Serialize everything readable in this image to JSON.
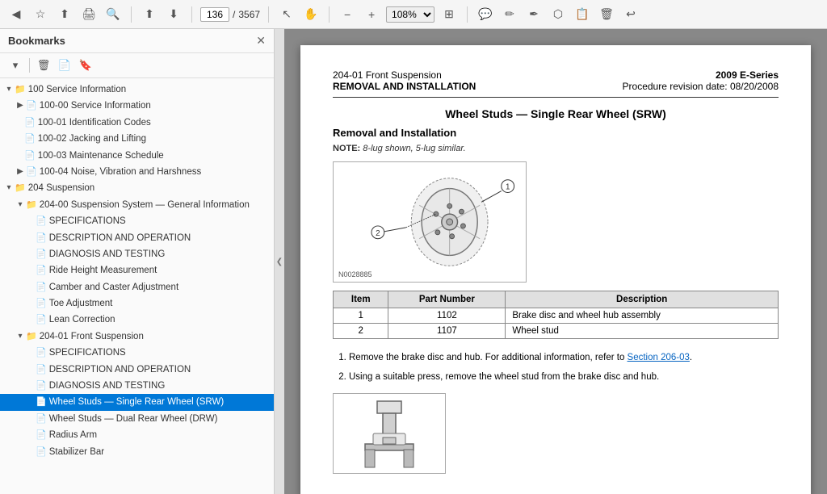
{
  "toolbar": {
    "page_current": "136",
    "page_total": "3567",
    "zoom": "108%",
    "nav_back_label": "◀",
    "nav_forward_label": "▶"
  },
  "sidebar": {
    "title": "Bookmarks",
    "close_btn": "✕",
    "tools": [
      "▾",
      "🗑",
      "📄",
      "🔖"
    ],
    "tree": [
      {
        "id": "s100",
        "indent": 0,
        "expanded": true,
        "type": "folder",
        "label": "100 Service Information"
      },
      {
        "id": "s100-00",
        "indent": 1,
        "expanded": false,
        "type": "file",
        "label": "100-00 Service Information"
      },
      {
        "id": "s100-01",
        "indent": 1,
        "expanded": false,
        "type": "file",
        "label": "100-01 Identification Codes"
      },
      {
        "id": "s100-02",
        "indent": 1,
        "expanded": false,
        "type": "file",
        "label": "100-02 Jacking and Lifting"
      },
      {
        "id": "s100-03",
        "indent": 1,
        "expanded": false,
        "type": "file",
        "label": "100-03 Maintenance Schedule"
      },
      {
        "id": "s100-04",
        "indent": 1,
        "expanded": false,
        "type": "file",
        "label": "100-04 Noise, Vibration and Harshness"
      },
      {
        "id": "s204",
        "indent": 0,
        "expanded": true,
        "type": "folder",
        "label": "204 Suspension"
      },
      {
        "id": "s204-00",
        "indent": 1,
        "expanded": true,
        "type": "subfolder",
        "label": "204-00 Suspension System — General Information"
      },
      {
        "id": "s204-00-spec",
        "indent": 2,
        "expanded": false,
        "type": "file",
        "label": "SPECIFICATIONS"
      },
      {
        "id": "s204-00-desc",
        "indent": 2,
        "expanded": false,
        "type": "file",
        "label": "DESCRIPTION AND OPERATION"
      },
      {
        "id": "s204-00-diag",
        "indent": 2,
        "expanded": false,
        "type": "file",
        "label": "DIAGNOSIS AND TESTING"
      },
      {
        "id": "s204-00-ride",
        "indent": 2,
        "expanded": false,
        "type": "file",
        "label": "Ride Height Measurement"
      },
      {
        "id": "s204-00-camber",
        "indent": 2,
        "expanded": false,
        "type": "file",
        "label": "Camber and Caster Adjustment"
      },
      {
        "id": "s204-00-toe",
        "indent": 2,
        "expanded": false,
        "type": "file",
        "label": "Toe Adjustment"
      },
      {
        "id": "s204-00-lean",
        "indent": 2,
        "expanded": false,
        "type": "file",
        "label": "Lean Correction"
      },
      {
        "id": "s204-01",
        "indent": 1,
        "expanded": true,
        "type": "subfolder",
        "label": "204-01 Front Suspension"
      },
      {
        "id": "s204-01-spec",
        "indent": 2,
        "expanded": false,
        "type": "file",
        "label": "SPECIFICATIONS"
      },
      {
        "id": "s204-01-desc",
        "indent": 2,
        "expanded": false,
        "type": "file",
        "label": "DESCRIPTION AND OPERATION"
      },
      {
        "id": "s204-01-diag",
        "indent": 2,
        "expanded": false,
        "type": "file",
        "label": "DIAGNOSIS AND TESTING"
      },
      {
        "id": "s204-01-wheel-srw",
        "indent": 2,
        "expanded": false,
        "type": "file",
        "label": "Wheel Studs — Single Rear Wheel (SRW)",
        "selected": true
      },
      {
        "id": "s204-01-wheel-drw",
        "indent": 2,
        "expanded": false,
        "type": "file",
        "label": "Wheel Studs — Dual Rear Wheel (DRW)"
      },
      {
        "id": "s204-01-radius",
        "indent": 2,
        "expanded": false,
        "type": "file",
        "label": "Radius Arm"
      },
      {
        "id": "s204-01-stab",
        "indent": 2,
        "expanded": false,
        "type": "file",
        "label": "Stabilizer Bar"
      }
    ]
  },
  "content": {
    "header_left": "204-01 Front Suspension",
    "header_left_sub": "REMOVAL AND INSTALLATION",
    "header_right": "2009 E-Series",
    "header_right_sub": "Procedure revision date: 08/20/2008",
    "title": "Wheel Studs — Single Rear Wheel (SRW)",
    "section_title": "Removal and Installation",
    "note_label": "NOTE:",
    "note_text": "8-lug shown, 5-lug similar.",
    "illustration_label": "N0028885",
    "callout1": "1",
    "callout2": "2",
    "table": {
      "col1": "Item",
      "col2": "Part Number",
      "col3": "Description",
      "rows": [
        {
          "item": "1",
          "part": "1102",
          "desc": "Brake disc and wheel hub assembly"
        },
        {
          "item": "2",
          "part": "1107",
          "desc": "Wheel stud"
        }
      ]
    },
    "steps": [
      {
        "text_pre": "Remove the brake disc and hub. For additional information, refer to ",
        "link": "Section  206-03",
        "text_post": "."
      },
      {
        "text": "Using a suitable press, remove the wheel stud from the brake disc and hub."
      }
    ]
  }
}
